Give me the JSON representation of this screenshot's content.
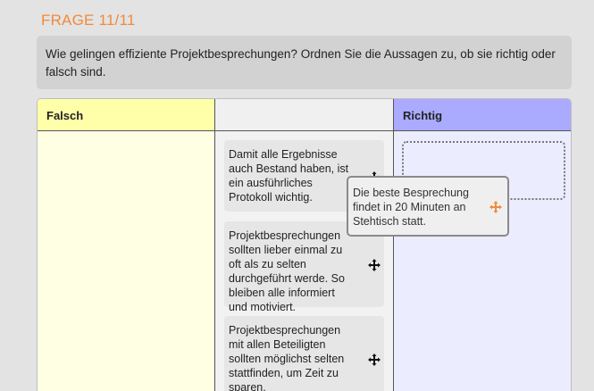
{
  "header": {
    "frage": "FRAGE 11/11"
  },
  "question": {
    "text": "Wie gelingen effiziente Projektbesprechungen? Ordnen Sie die Aussagen zu, ob sie richtig oder falsch sind."
  },
  "columns": {
    "falsch": "Falsch",
    "middle": "",
    "richtig": "Richtig"
  },
  "cards": [
    {
      "text": "Damit alle Ergebnisse auch Bestand haben, ist ein ausführliches Protokoll wichtig.",
      "icon": "move-icon"
    },
    {
      "text": "Projektbesprechungen sollten lieber einmal zu oft als zu selten durchgeführt werde. So bleiben alle informiert und motiviert.",
      "icon": "move-icon"
    },
    {
      "text": "Projektbesprechungen mit allen Beteiligten sollten möglichst selten stattfinden, um Zeit zu sparen.",
      "icon": "move-icon"
    }
  ],
  "dragging_card": {
    "text": "Die beste Besprechung findet in 20 Minuten an Stehtisch statt.",
    "icon": "move-icon-orange"
  },
  "colors": {
    "accent": "#f08a3c",
    "falsch_header": "#ffffaa",
    "richtig_header": "#aaaaff"
  }
}
